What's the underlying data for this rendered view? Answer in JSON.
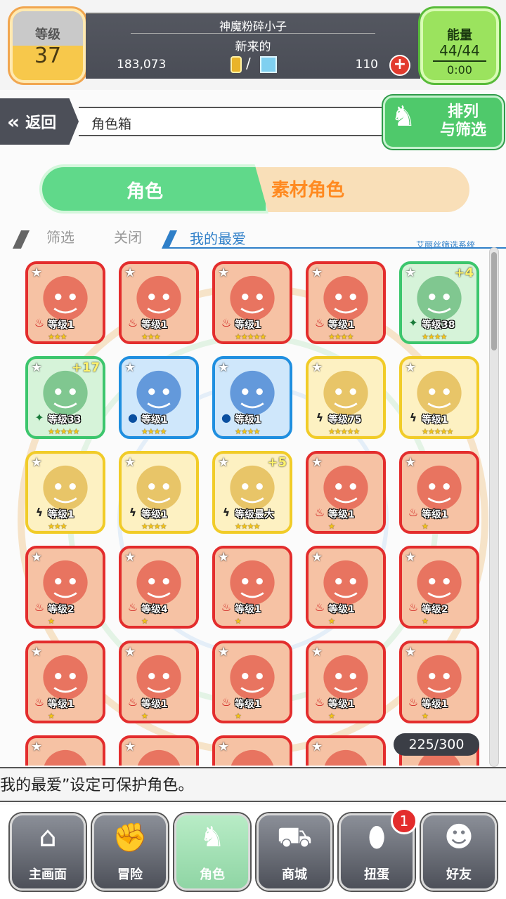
{
  "header": {
    "level_label": "等级",
    "level_value": "37",
    "player_name": "神魔粉碎小子",
    "player_title": "新来的",
    "gold": "183,073",
    "separator": "/",
    "gems": "110",
    "energy_label": "能量",
    "energy_value": "44/44",
    "energy_timer": "0:00"
  },
  "nav_row": {
    "back_label": "返回",
    "back_icon": "double-chevron-left-icon",
    "breadcrumb": "角色箱",
    "sort_line1": "排列",
    "sort_line2": "与筛选"
  },
  "tabs": [
    {
      "label": "角色",
      "active": true
    },
    {
      "label": "素材角色",
      "active": false
    }
  ],
  "filter": {
    "filter_label": "筛选",
    "filter_value": "关闭",
    "favorites_label": "我的最爱",
    "system_label": "艾丽丝筛选系统"
  },
  "cards": [
    {
      "border": "r",
      "element": "fire",
      "level": "等级1",
      "stars": "★★★",
      "plus": ""
    },
    {
      "border": "r",
      "element": "fire",
      "level": "等级1",
      "stars": "★★★",
      "plus": ""
    },
    {
      "border": "r",
      "element": "fire",
      "level": "等级1",
      "stars": "★★★★★",
      "plus": ""
    },
    {
      "border": "r",
      "element": "fire",
      "level": "等级1",
      "stars": "★★★★",
      "plus": ""
    },
    {
      "border": "g",
      "element": "wood",
      "level": "等级38",
      "stars": "★★★★",
      "plus": "+4"
    },
    {
      "border": "g",
      "element": "wood",
      "level": "等级33",
      "stars": "★★★★★",
      "plus": "+17"
    },
    {
      "border": "b",
      "element": "water",
      "level": "等级1",
      "stars": "★★★★",
      "plus": ""
    },
    {
      "border": "b",
      "element": "water",
      "level": "等级1",
      "stars": "★★★★",
      "plus": ""
    },
    {
      "border": "y",
      "element": "thunder",
      "level": "等级75",
      "stars": "★★★★★",
      "plus": ""
    },
    {
      "border": "y",
      "element": "thunder",
      "level": "等级1",
      "stars": "★★★★★",
      "plus": ""
    },
    {
      "border": "y",
      "element": "thunder",
      "level": "等级1",
      "stars": "★★★",
      "plus": ""
    },
    {
      "border": "y",
      "element": "thunder",
      "level": "等级1",
      "stars": "★★★★",
      "plus": ""
    },
    {
      "border": "y",
      "element": "thunder",
      "level": "等级最大",
      "stars": "★★★★",
      "plus": "+5"
    },
    {
      "border": "r",
      "element": "fire",
      "level": "等级1",
      "stars": "★",
      "plus": ""
    },
    {
      "border": "r",
      "element": "fire",
      "level": "等级1",
      "stars": "★",
      "plus": ""
    },
    {
      "border": "r",
      "element": "fire",
      "level": "等级2",
      "stars": "★",
      "plus": ""
    },
    {
      "border": "r",
      "element": "fire",
      "level": "等级4",
      "stars": "★",
      "plus": ""
    },
    {
      "border": "r",
      "element": "fire",
      "level": "等级1",
      "stars": "★",
      "plus": ""
    },
    {
      "border": "r",
      "element": "fire",
      "level": "等级1",
      "stars": "★",
      "plus": ""
    },
    {
      "border": "r",
      "element": "fire",
      "level": "等级2",
      "stars": "★",
      "plus": ""
    },
    {
      "border": "r",
      "element": "fire",
      "level": "等级1",
      "stars": "★",
      "plus": ""
    },
    {
      "border": "r",
      "element": "fire",
      "level": "等级1",
      "stars": "★",
      "plus": ""
    },
    {
      "border": "r",
      "element": "fire",
      "level": "等级1",
      "stars": "★",
      "plus": ""
    },
    {
      "border": "r",
      "element": "fire",
      "level": "等级1",
      "stars": "★",
      "plus": ""
    },
    {
      "border": "r",
      "element": "fire",
      "level": "等级1",
      "stars": "★",
      "plus": ""
    },
    {
      "border": "r",
      "element": "fire",
      "level": "",
      "stars": "",
      "plus": ""
    },
    {
      "border": "r",
      "element": "fire",
      "level": "",
      "stars": "",
      "plus": ""
    },
    {
      "border": "r",
      "element": "fire",
      "level": "",
      "stars": "",
      "plus": ""
    },
    {
      "border": "r",
      "element": "fire",
      "level": "",
      "stars": "",
      "plus": ""
    },
    {
      "border": "r",
      "element": "fire",
      "level": "",
      "stars": "",
      "plus": ""
    }
  ],
  "box_count": "225/300",
  "ticker": "我的最爱”设定可保护角色。",
  "bottom_nav": [
    {
      "label": "主画面",
      "icon": "home-icon",
      "active": false
    },
    {
      "label": "冒险",
      "icon": "handshake-icon",
      "active": false
    },
    {
      "label": "角色",
      "icon": "rabbit-icon",
      "active": true
    },
    {
      "label": "商城",
      "icon": "cart-icon",
      "active": false
    },
    {
      "label": "扭蛋",
      "icon": "egg-icon",
      "active": false
    },
    {
      "label": "好友",
      "icon": "friends-icon",
      "active": false
    }
  ],
  "gacha_badge": "1",
  "colors": {
    "fire": "#e32d2d",
    "water": "#1f8fe0",
    "wood": "#3cc66d",
    "thunder": "#f1cc28",
    "accent_green": "#4fc96b",
    "accent_orange": "#ff8a21"
  }
}
